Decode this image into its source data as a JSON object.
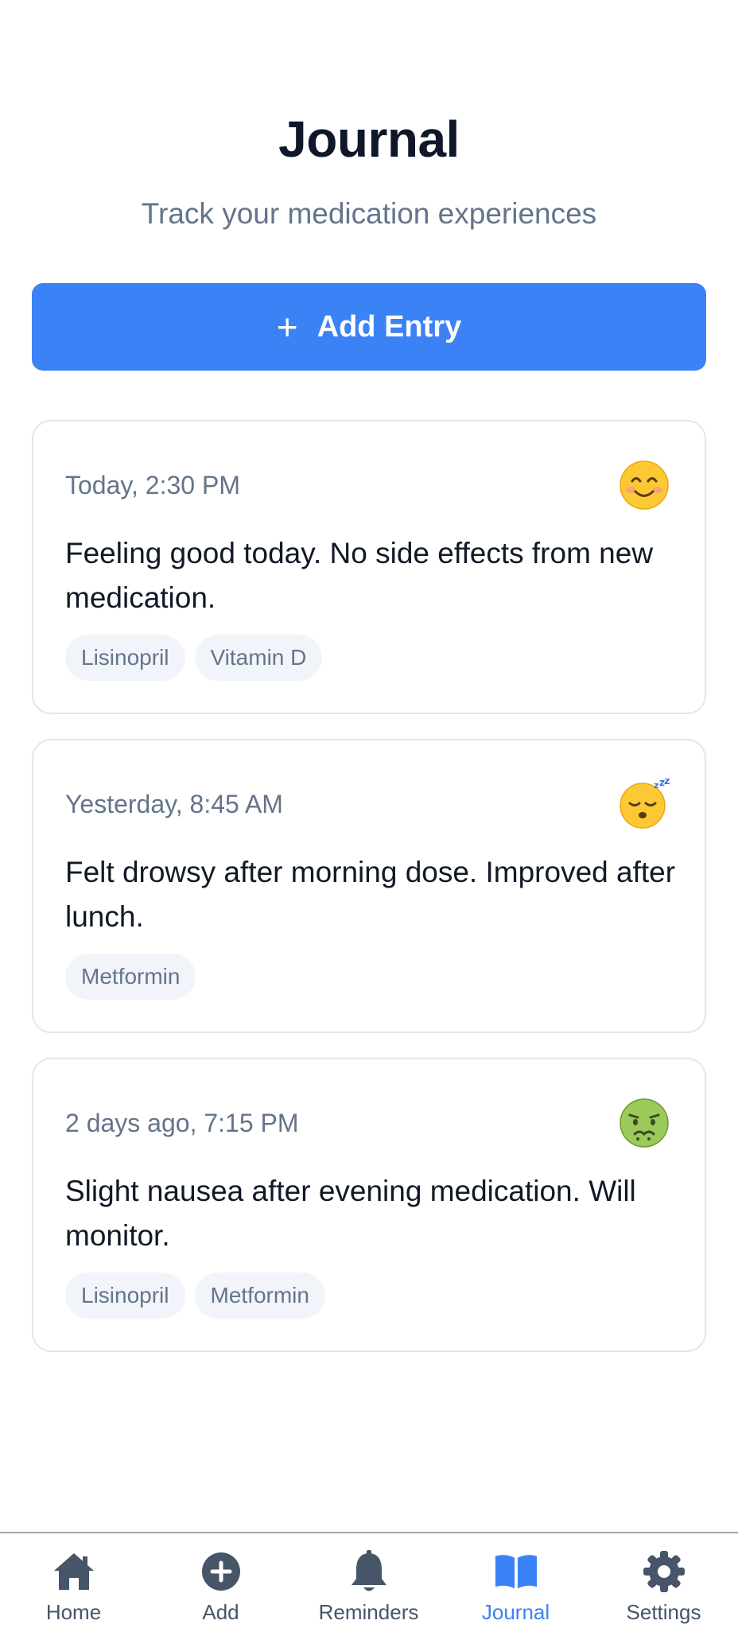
{
  "header": {
    "title": "Journal",
    "subtitle": "Track your medication experiences"
  },
  "add_button": {
    "icon": "plus-icon",
    "label": "Add Entry"
  },
  "entries": [
    {
      "date": "Today, 2:30 PM",
      "mood_icon": "smiling-face-icon",
      "text": "Feeling good today. No side effects from new medication.",
      "tags": [
        "Lisinopril",
        "Vitamin D"
      ]
    },
    {
      "date": "Yesterday, 8:45 AM",
      "mood_icon": "sleepy-face-icon",
      "text": "Felt drowsy after morning dose. Improved after lunch.",
      "tags": [
        "Metformin"
      ]
    },
    {
      "date": "2 days ago, 7:15 PM",
      "mood_icon": "nauseated-face-icon",
      "text": "Slight nausea after evening medication. Will monitor.",
      "tags": [
        "Lisinopril",
        "Metformin"
      ]
    }
  ],
  "nav": {
    "active": "Journal",
    "items": [
      {
        "label": "Home",
        "icon": "home-icon"
      },
      {
        "label": "Add",
        "icon": "plus-circle-icon"
      },
      {
        "label": "Reminders",
        "icon": "bell-icon"
      },
      {
        "label": "Journal",
        "icon": "book-icon"
      },
      {
        "label": "Settings",
        "icon": "gear-icon"
      }
    ]
  },
  "colors": {
    "accent": "#3b82f6",
    "muted_text": "#64748b",
    "tag_bg": "#f1f5f9",
    "nav_icon": "#475569"
  }
}
